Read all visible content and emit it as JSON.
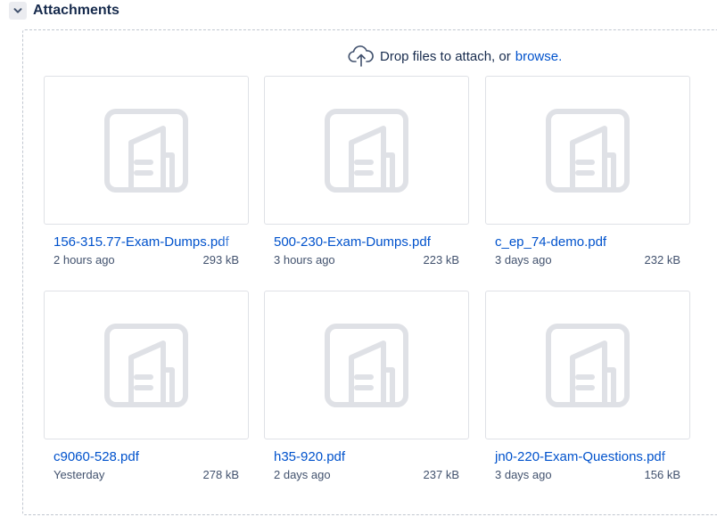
{
  "section": {
    "title": "Attachments"
  },
  "dropzone": {
    "message": "Drop files to attach, or",
    "browse_label": "browse."
  },
  "attachments": [
    {
      "name": "156-315.77-Exam-Dumps.pdf",
      "time": "2 hours ago",
      "size": "293 kB"
    },
    {
      "name": "500-230-Exam-Dumps.pdf",
      "time": "3 hours ago",
      "size": "223 kB"
    },
    {
      "name": "c_ep_74-demo.pdf",
      "time": "3 days ago",
      "size": "232 kB"
    },
    {
      "name": "c9060-528.pdf",
      "time": "Yesterday",
      "size": "278 kB"
    },
    {
      "name": "h35-920.pdf",
      "time": "2 days ago",
      "size": "237 kB"
    },
    {
      "name": "jn0-220-Exam-Questions.pdf",
      "time": "3 days ago",
      "size": "156 kB"
    }
  ],
  "colors": {
    "link": "#0052cc",
    "text": "#172b4d",
    "muted": "#42526e",
    "border": "#dfe1e6",
    "icon": "#dfe1e6"
  }
}
